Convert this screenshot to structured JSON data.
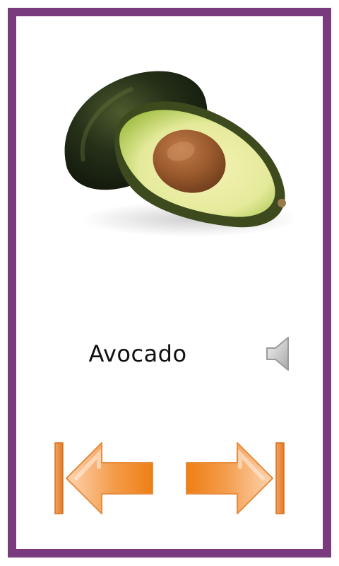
{
  "card": {
    "word": "Avocado",
    "image": "avocado-photo"
  },
  "controls": {
    "speaker_icon": "speaker-icon",
    "prev_icon": "skip-previous-arrow-icon",
    "next_icon": "skip-next-arrow-icon"
  },
  "colors": {
    "border": "#7a3b7e",
    "arrow_orange": "#f39c4b",
    "arrow_orange_dark": "#e57e1f"
  }
}
